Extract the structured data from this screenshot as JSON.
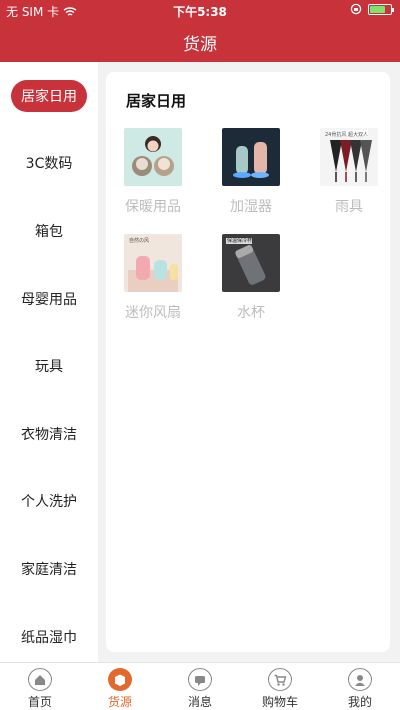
{
  "status": {
    "carrier": "无 SIM 卡",
    "time": "下午5:38",
    "battery_level": 0.75
  },
  "header": {
    "title": "货源"
  },
  "sidebar": {
    "items": [
      {
        "label": "居家日用",
        "active": true
      },
      {
        "label": "3C数码"
      },
      {
        "label": "箱包"
      },
      {
        "label": "母婴用品"
      },
      {
        "label": "玩具"
      },
      {
        "label": "衣物清洁"
      },
      {
        "label": "个人洗护"
      },
      {
        "label": "家庭清洁"
      },
      {
        "label": "纸品湿巾"
      }
    ]
  },
  "content": {
    "title": "居家日用",
    "items": [
      {
        "label": "保暖用品",
        "icon": "plush-toys-image"
      },
      {
        "label": "加湿器",
        "icon": "humidifier-image"
      },
      {
        "label": "雨具",
        "icon": "umbrellas-image",
        "caption": "24骨抗风 超大双人"
      },
      {
        "label": "迷你风扇",
        "icon": "mini-fan-image",
        "caption": "自然の风"
      },
      {
        "label": "水杯",
        "icon": "water-cup-image",
        "caption": "保温保冷杯"
      }
    ]
  },
  "tabbar": {
    "items": [
      {
        "label": "首页",
        "icon": "home-icon"
      },
      {
        "label": "货源",
        "icon": "source-box-icon",
        "active": true
      },
      {
        "label": "消息",
        "icon": "message-icon"
      },
      {
        "label": "购物车",
        "icon": "cart-icon"
      },
      {
        "label": "我的",
        "icon": "profile-icon"
      }
    ]
  },
  "colors": {
    "brand": "#c8323a",
    "accent": "#e26a2e",
    "muted_label": "#bdbdbd"
  }
}
